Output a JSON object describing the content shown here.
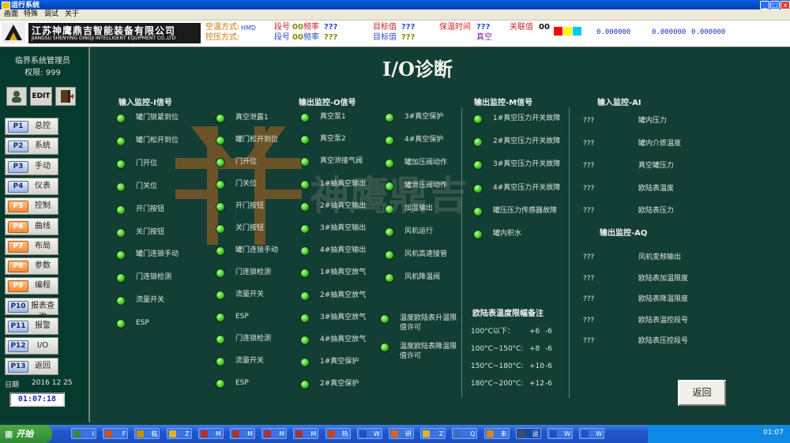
{
  "window": {
    "title": "运行系统"
  },
  "menubar": [
    "画面",
    "特殊",
    "调试",
    "关于"
  ],
  "header": {
    "company_cn": "江苏神鹰鼎吉智能装备有限公司",
    "company_en": "JIANGSU SHENYING DINGJI INTELLIGENT EQUIPMENT CO.,LTD",
    "mode1_label": "空温方式:",
    "mode1_value": "HMD",
    "mode2_label": "控压方式:",
    "seg_label": "段号",
    "seg_value": "00",
    "rate_label": "频率",
    "rate_value": "???",
    "seg2_label": "段号",
    "seg2_value": "00",
    "rate2_label": "频率",
    "rate2_value": "???",
    "target_label": "目标值",
    "target_value": "???",
    "target2_label": "目标值",
    "target2_value": "???",
    "hold_label": "保温时间",
    "hold_value": "???",
    "off_label": "关联值",
    "off_value": "00",
    "vacuum": "真空",
    "swatch_colors": [
      "#ff0000",
      "#ffff00",
      "#00c8ff"
    ],
    "coords": [
      "0.000000",
      "0.000000",
      "0.000000"
    ]
  },
  "sidebar": {
    "manager": "临界系统管理员",
    "perm_label": "权限:",
    "perm_value": "999",
    "edit_label": "EDIT",
    "nav": [
      {
        "code": "P1",
        "label": "总控"
      },
      {
        "code": "P2",
        "label": "系统"
      },
      {
        "code": "P3",
        "label": "手动"
      },
      {
        "code": "P4",
        "label": "仪表"
      },
      {
        "code": "P5",
        "label": "控制"
      },
      {
        "code": "P6",
        "label": "曲线"
      },
      {
        "code": "P7",
        "label": "布局"
      },
      {
        "code": "P8",
        "label": "参数"
      },
      {
        "code": "P9",
        "label": "编程"
      },
      {
        "code": "P10",
        "label": "报表查询"
      },
      {
        "code": "P11",
        "label": "报警"
      },
      {
        "code": "P12",
        "label": "I/O"
      },
      {
        "code": "P13",
        "label": "返回"
      }
    ],
    "date_label": "日期",
    "date_value": "2016 12 25",
    "time": "01:07:18"
  },
  "main": {
    "title": "I/O诊断",
    "sections": {
      "i": "输入监控-I信号",
      "o": "输出监控-O信号",
      "m": "输出监控-M信号",
      "ai": "输入监控-AI",
      "aq": "输出监控-AQ",
      "table": "欧陆表温度限幅备注"
    },
    "i_col1": [
      "罐门锁紧到位",
      "罐门松开到位",
      "门开位",
      "门关位",
      "开门按钮",
      "关门按钮",
      "罐门连锁手动",
      "门连锁检测",
      "流量开关",
      "ESP"
    ],
    "i_col2": [
      "真空泄露1",
      "罐门松开到位",
      "门开位",
      "门关位",
      "开门按钮",
      "关门按钮",
      "罐门连锁手动",
      "门连锁检测",
      "流量开关",
      "ESP",
      "门连锁检测",
      "流量开关",
      "ESP"
    ],
    "o_col1": [
      "真空泵1",
      "真空泵2",
      "真空泄接气阀",
      "1#抽真空输出",
      "2#抽真空输出",
      "3#抽真空输出",
      "4#抽真空输出",
      "1#抽真空放气",
      "2#抽真空放气",
      "3#抽真空放气",
      "4#抽真空放气",
      "1#真空保护",
      "2#真空保护"
    ],
    "o_col2": [
      "3#真空保护",
      "4#真空保护",
      "罐加压阀动作",
      "罐泄压阀动作",
      "加湿输出",
      "风机运行",
      "风机高速接管",
      "风机降温阀"
    ],
    "o_col3": [
      "温度欧陆表升温限值许可",
      "温度欧陆表降温限值许可"
    ],
    "m_signals": [
      "1#真空压力开关故障",
      "2#真空压力开关故障",
      "3#真空压力开关故障",
      "4#真空压力开关故障",
      "罐压压力传感器故障",
      "罐内积水"
    ],
    "ai_items": [
      {
        "value": "???",
        "label": "罐内压力"
      },
      {
        "value": "???",
        "label": "罐内介质温度"
      },
      {
        "value": "???",
        "label": "真空罐压力"
      },
      {
        "value": "???",
        "label": "欧陆表温度"
      },
      {
        "value": "???",
        "label": "欧陆表压力"
      }
    ],
    "aq_items": [
      {
        "value": "???",
        "label": "风机变频输出"
      },
      {
        "value": "???",
        "label": "欧陆表加温限度"
      },
      {
        "value": "???",
        "label": "欧陆表降温限度"
      },
      {
        "value": "???",
        "label": "欧陆表温控段号"
      },
      {
        "value": "???",
        "label": "欧陆表压控段号"
      }
    ],
    "table_rows": [
      {
        "range": "100°C以下：",
        "val1": "+6",
        "val2": "-6"
      },
      {
        "range": "100°C~150°C:",
        "val1": "+8",
        "val2": "-6"
      },
      {
        "range": "150°C~180°C:",
        "val1": "+10",
        "val2": "-6"
      },
      {
        "range": "180°C~200°C:",
        "val1": "+12",
        "val2": "-6"
      }
    ],
    "return_label": "返回",
    "watermark_text": "神鹰鼎吉"
  },
  "taskbar": {
    "start": "开始",
    "tasks": [
      "I",
      "F",
      "临",
      "Z",
      "M",
      "M",
      "M",
      "M",
      "热",
      "W",
      "研",
      "Z",
      "Q",
      "未",
      "运",
      "W",
      "W"
    ],
    "clock": "01:07"
  }
}
